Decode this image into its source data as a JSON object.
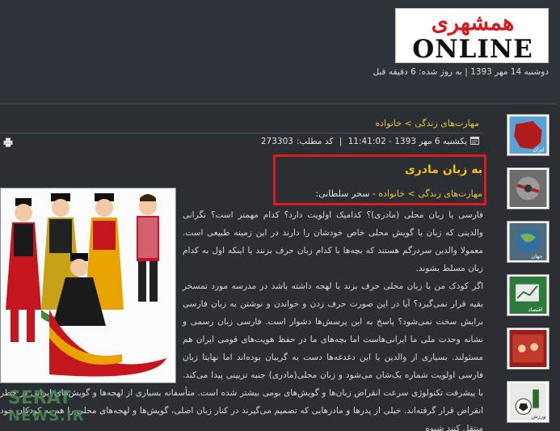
{
  "header": {
    "logo_fa": "همشهری",
    "logo_en": "ONLINE",
    "dateline": "دوشنبه 14 مهر 1393 | به روز شده: 6 دقیقه قبل"
  },
  "article": {
    "breadcrumb": "مهارت‌های زندگی > خانواده",
    "date": "یکشنبه 6 مهر 1393 - 11:41:02",
    "code_label": "کد مطلب:",
    "code": "273303",
    "title": "به زبان مادری",
    "sub_link": "مهارت‌های زندگی > خانواده",
    "author": " - سحر سلطانی:",
    "paragraph1": "فارسی یا زبان محلی (مادری)؟ کدامیک اولویت دارد؟ کدام مهمتر است؟ نگرانی والدینی که زبان یا گویش محلی خاص خودشان را دارند در این زمینه طبیعی است. معمولا والدین سردرگم هستند که بچه‌ها با کدام زبان حرف بزنند یا اینکه اول به کدام زبان مسلط بشوند.",
    "paragraph2": "اگر کودک من با زبان محلی حرف بزند یا لهجه داشته باشد در مدرسه مورد تمسخر بقیه قرار نمی‌گیرد؟ آیا در این صورت حرف زدن و خواندن و نوشتن به زبان فارسی برایش سخت نمی‌شود؟ پاسخ به این پرسش‌ها دشوار است. فارسی زبان رسمی و نشانه وحدت ملی ما ایرانی‌هاست اما بچه‌های ما در حفظ هویت‌های قومی ایران هم مسئولند. بسیاری از والدین با این دغدغه‌ها دست به گریبان بوده‌اند اما نهایتا زبان فارسی اولویت شماره یک‌شان می‌شود و زبان محلی(مادری) جنبه تزیینی پیدا می‌کند. با پیشرفت تکنولوژی سرعت انقراض زبان‌ها و گویش‌های بومی بیشتر شده است. متأسفانه بسیاری از لهجه‌ها و گویش‌های ایرانی در خطر انقراض قرار گرفته‌اند. خیلی از پدرها و مادرهایی که تصمیم می‌گیرند در کنار زبان اصلی، گویش‌ها و لهجه‌های محلی را هم به کودکان خود منتقل کنند شیوه"
  },
  "sidebar": {
    "thumbs": [
      {
        "caption": "ایران"
      },
      {
        "caption": ""
      },
      {
        "caption": "جهان"
      },
      {
        "caption": "اقتصاد"
      },
      {
        "caption": ""
      },
      {
        "caption": "ورزش"
      }
    ]
  },
  "watermark": {
    "line1": "SERAT",
    "line2": "NEWS.IR"
  },
  "colors": {
    "accent": "#e3c23e",
    "title": "#f2c01a",
    "highlight_box": "#e0191f",
    "background": "#2e3339"
  }
}
